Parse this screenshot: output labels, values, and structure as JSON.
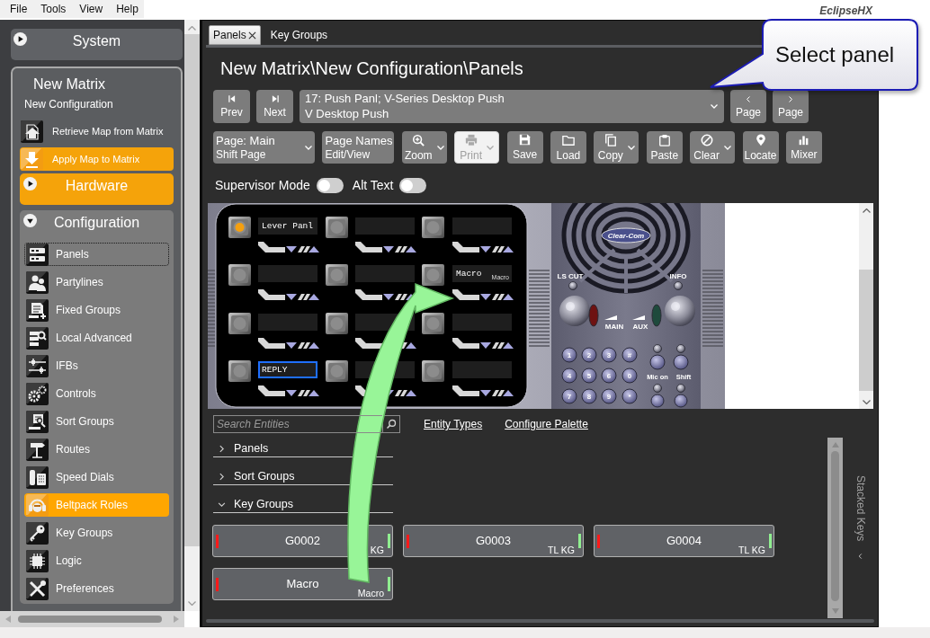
{
  "menu_bar": {
    "items": [
      "File",
      "Tools",
      "View",
      "Help"
    ],
    "logo": "EclipseHX"
  },
  "sidebar": {
    "system": {
      "title": "System",
      "expanded": false
    },
    "matrix": {
      "title": "New Matrix",
      "subtitle": "New Configuration",
      "actions": [
        {
          "label": "Retrieve Map from Matrix",
          "highlighted": false
        },
        {
          "label": "Apply Map to Matrix",
          "highlighted": true
        }
      ],
      "groups": [
        {
          "title": "Hardware",
          "expanded": false,
          "highlighted": true
        },
        {
          "title": "Configuration",
          "expanded": true,
          "highlighted": false,
          "items": [
            {
              "label": "Panels",
              "selected": false,
              "focused": true
            },
            {
              "label": "Partylines",
              "selected": false,
              "focused": false
            },
            {
              "label": "Fixed Groups",
              "selected": false,
              "focused": false
            },
            {
              "label": "Local Advanced",
              "selected": false,
              "focused": false
            },
            {
              "label": "IFBs",
              "selected": false,
              "focused": false
            },
            {
              "label": "Controls",
              "selected": false,
              "focused": false
            },
            {
              "label": "Sort Groups",
              "selected": false,
              "focused": false
            },
            {
              "label": "Routes",
              "selected": false,
              "focused": false
            },
            {
              "label": "Speed Dials",
              "selected": false,
              "focused": false
            },
            {
              "label": "Beltpack Roles",
              "selected": true,
              "focused": false
            },
            {
              "label": "Key Groups",
              "selected": false,
              "focused": false
            },
            {
              "label": "Logic",
              "selected": false,
              "focused": false
            },
            {
              "label": "Preferences",
              "selected": false,
              "focused": false
            }
          ]
        }
      ]
    }
  },
  "tabs": [
    {
      "label": "Panels",
      "selected": true,
      "closable": true
    },
    {
      "label": "Key Groups",
      "selected": false,
      "closable": false
    }
  ],
  "header": {
    "title": "New Matrix\\New Configuration\\Panels"
  },
  "navigation": {
    "buttons": [
      {
        "label": "Prev"
      },
      {
        "label": "Next"
      }
    ],
    "panel_select": {
      "line_1": "17: Push Panl; V-Series Desktop Push",
      "line_2": "V Desktop Push"
    },
    "page_buttons": [
      {
        "label": "Page"
      },
      {
        "label": "Page"
      }
    ]
  },
  "toolbar": [
    {
      "kind": "two_line",
      "line_1": "Page: Main",
      "line_2": "Shift Page",
      "dropdown": true,
      "disabled": false
    },
    {
      "kind": "two_line",
      "line_1": "Page Names",
      "line_2": "Edit/View",
      "dropdown": false,
      "disabled": false
    },
    {
      "kind": "icon",
      "label": "Zoom",
      "dropdown": true,
      "disabled": false
    },
    {
      "kind": "icon",
      "label": "Print",
      "dropdown": true,
      "disabled": true
    },
    {
      "kind": "icon",
      "label": "Save",
      "dropdown": false,
      "disabled": false
    },
    {
      "kind": "icon",
      "label": "Load",
      "dropdown": false,
      "disabled": false
    },
    {
      "kind": "icon",
      "label": "Copy",
      "dropdown": true,
      "disabled": false
    },
    {
      "kind": "icon",
      "label": "Paste",
      "dropdown": false,
      "disabled": false
    },
    {
      "kind": "icon",
      "label": "Clear",
      "dropdown": true,
      "disabled": false
    },
    {
      "kind": "icon",
      "label": "Locate",
      "dropdown": false,
      "disabled": false
    },
    {
      "kind": "icon",
      "label": "Mixer",
      "dropdown": false,
      "disabled": false
    }
  ],
  "toggles": [
    {
      "label": "Supervisor Mode",
      "on": false
    },
    {
      "label": "Alt Text",
      "on": false
    }
  ],
  "panel_view": {
    "keys": [
      {
        "label": "Lever Panl",
        "lit": true,
        "selected": false
      },
      {
        "lit": false,
        "selected": false
      },
      {
        "lit": false,
        "selected": false
      },
      {
        "lit": false,
        "selected": false
      },
      {
        "lit": false,
        "selected": false
      },
      {
        "label": "Macro",
        "sublabel": "Macro",
        "lit": false,
        "selected": false
      },
      {
        "lit": false,
        "selected": false
      },
      {
        "lit": false,
        "selected": false
      },
      {
        "lit": false,
        "selected": false
      },
      {
        "label": "REPLY",
        "lit": false,
        "selected": true
      },
      {
        "lit": false,
        "selected": false
      },
      {
        "lit": false,
        "selected": false
      }
    ],
    "device": {
      "logo": "Clear-Com",
      "top_buttons": [
        "LS CUT",
        "INFO"
      ],
      "level_labels": [
        "MAIN",
        "AUX"
      ],
      "keypad": [
        "1",
        "2",
        "3",
        "#",
        "4",
        "5",
        "6",
        "0",
        "7",
        "8",
        "9",
        "*"
      ],
      "side_buttons": [
        "Mic on",
        "Shift"
      ]
    }
  },
  "entities": {
    "search": {
      "placeholder": "Search Entities"
    },
    "links": [
      "Entity Types",
      "Configure Palette"
    ],
    "categories": [
      {
        "label": "Panels",
        "expanded": false
      },
      {
        "label": "Sort Groups",
        "expanded": false
      },
      {
        "label": "Key Groups",
        "expanded": true,
        "cards": [
          {
            "name": "G0002",
            "tag": "KG"
          },
          {
            "name": "G0003",
            "tag": "TL KG"
          },
          {
            "name": "G0004",
            "tag": "TL KG"
          },
          {
            "name": "Macro",
            "tag": "Macro"
          }
        ]
      }
    ],
    "side_panel": {
      "label": "Stacked Keys"
    }
  },
  "callout": {
    "text": "Select panel"
  }
}
